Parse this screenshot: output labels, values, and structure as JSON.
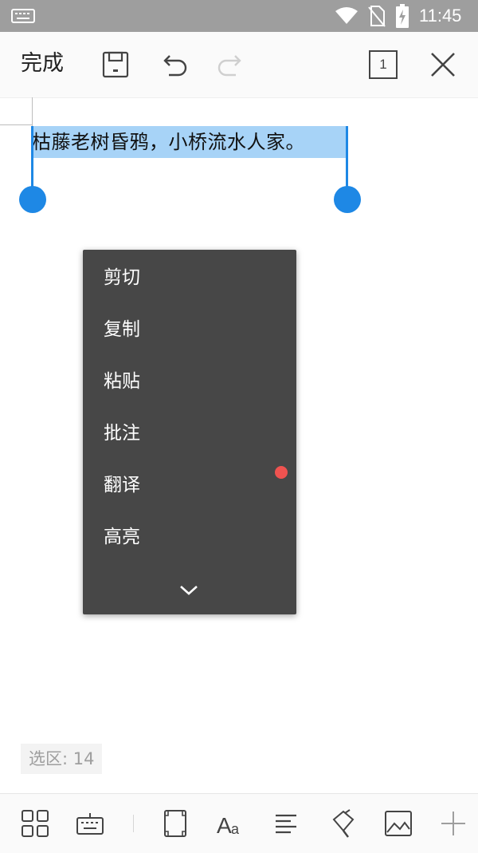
{
  "status_bar": {
    "time": "11:45",
    "icons": [
      "keyboard-icon",
      "wifi-icon",
      "no-sim-icon",
      "battery-charging-icon"
    ]
  },
  "toolbar": {
    "done_label": "完成",
    "icons": [
      "save-icon",
      "undo-icon",
      "redo-icon",
      "page-count-icon",
      "close-icon"
    ],
    "page_count": "1"
  },
  "document": {
    "selected_text": "枯藤老树昏鸦，小桥流水人家。"
  },
  "context_menu": {
    "items": [
      "剪切",
      "复制",
      "粘贴",
      "批注",
      "翻译",
      "高亮"
    ],
    "more_icon": "chevron-down-icon"
  },
  "selection_info": {
    "label": "选区: 14"
  },
  "bottom_toolbar": {
    "icons": [
      "apps-grid-icon",
      "keyboard-icon",
      "page-frame-icon",
      "font-icon",
      "align-icon",
      "format-painter-icon",
      "image-icon",
      "add-icon"
    ],
    "colors": {
      "accent": "#1e88e5",
      "selection": "#a7d3f7",
      "menu_bg": "#474747",
      "dot": "#ef5350"
    }
  }
}
